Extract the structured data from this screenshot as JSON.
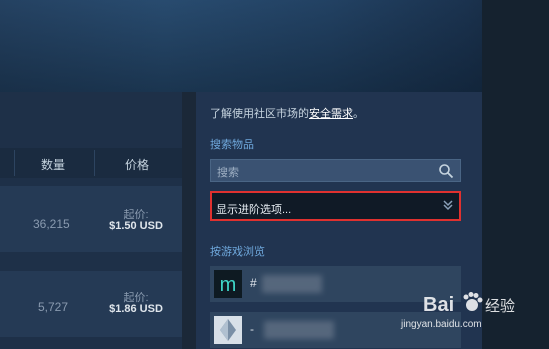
{
  "table": {
    "headers": {
      "quantity": "数量",
      "price": "价格"
    },
    "rows": [
      {
        "quantity": "36,215",
        "price_label": "起价:",
        "price": "$1.50 USD"
      },
      {
        "quantity": "5,727",
        "price_label": "起价:",
        "price": "$1.86 USD"
      }
    ]
  },
  "sidebar": {
    "intro_text": "了解使用社区市场的",
    "intro_link": "安全需求",
    "intro_suffix": "。",
    "search_heading": "搜索物品",
    "search_placeholder": "搜索",
    "advanced_label": "显示进阶选项...",
    "browse_heading": "按游戏浏览",
    "games": [
      {
        "name": "#",
        "icon": "m-logo-icon"
      },
      {
        "name": "-",
        "icon": "crystal-logo-icon"
      }
    ]
  },
  "watermark": {
    "brand": "Bai",
    "brand_suffix": "经验",
    "url": "jingyan.baidu.com"
  },
  "colors": {
    "background": "#1b2838",
    "highlight_border": "#e0312f",
    "link": "#6fa8dc"
  }
}
